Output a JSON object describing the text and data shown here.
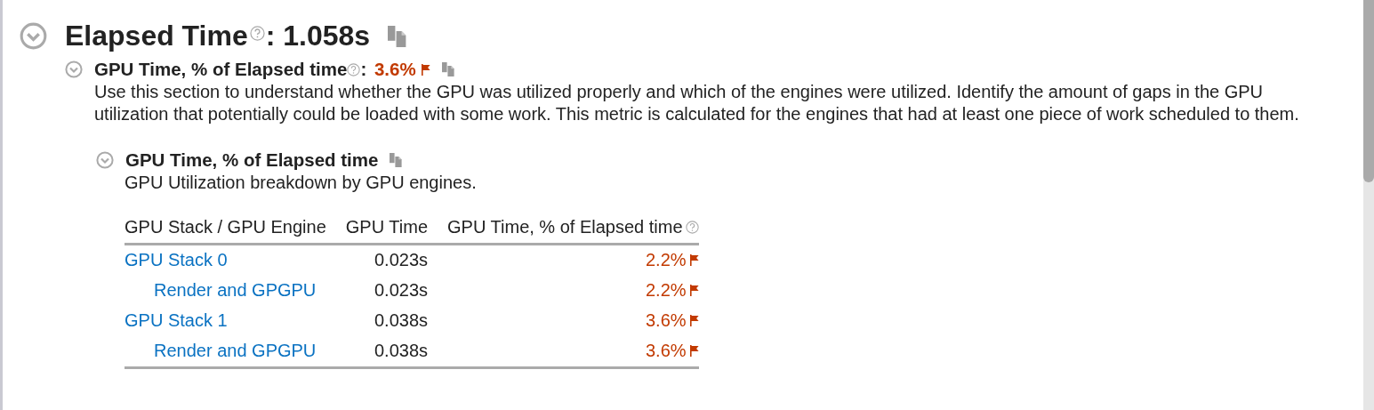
{
  "section": {
    "title": "Elapsed Time",
    "separator": ":",
    "value": "1.058s",
    "expanded": true,
    "help": true,
    "subsection": {
      "title": "GPU Time, % of Elapsed time",
      "separator": ":",
      "value": "3.6%",
      "flagged": true,
      "expanded": true,
      "help": true,
      "description": "Use this section to understand whether the GPU was utilized properly and which of the engines were utilized. Identify the amount of gaps in the GPU utilization that potentially could be loaded with some work. This metric is calculated for the engines that had at least one piece of work scheduled to them.",
      "group": {
        "title": "GPU Time, % of Elapsed time",
        "expanded": true,
        "description": "GPU Utilization breakdown by GPU engines.",
        "table": {
          "columns": [
            {
              "label": "GPU Stack / GPU Engine",
              "help": false
            },
            {
              "label": "GPU Time",
              "help": false
            },
            {
              "label": "GPU Time, % of Elapsed time",
              "help": true
            }
          ],
          "rows": [
            {
              "name": "GPU Stack 0",
              "time": "0.023s",
              "percent": "2.2%",
              "flagged": true,
              "children": [
                {
                  "name": "Render and GPGPU",
                  "time": "0.023s",
                  "percent": "2.2%",
                  "flagged": true
                }
              ]
            },
            {
              "name": "GPU Stack 1",
              "time": "0.038s",
              "percent": "3.6%",
              "flagged": true,
              "children": [
                {
                  "name": "Render and GPGPU",
                  "time": "0.038s",
                  "percent": "3.6%",
                  "flagged": true
                }
              ]
            }
          ]
        }
      }
    }
  }
}
